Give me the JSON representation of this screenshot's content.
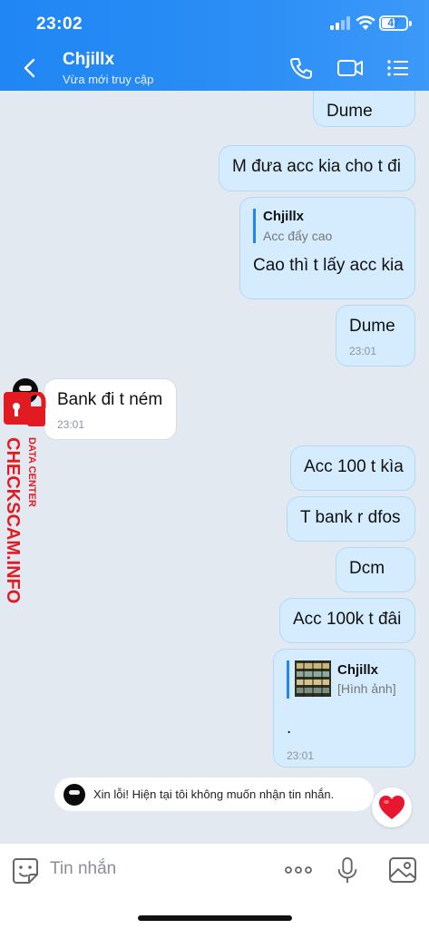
{
  "status_bar": {
    "time": "23:02",
    "battery": "47"
  },
  "header": {
    "contact_name": "Chjillx",
    "status": "Vừa mới truy cập"
  },
  "messages": {
    "m1": {
      "text": "Dume"
    },
    "m2": {
      "text": "M đưa acc kia cho t đi"
    },
    "m3": {
      "quote_name": "Chjillx",
      "quote_text": "Acc đẩy cao",
      "text": "Cao thì t lấy acc kia"
    },
    "m4": {
      "text": "Dume",
      "time": "23:01"
    },
    "m5": {
      "text": "Bank đi t ném",
      "time": "23:01"
    },
    "m6": {
      "text": "Acc 100 t kìa"
    },
    "m7": {
      "text": "T bank r dfos"
    },
    "m8": {
      "text": "Dcm"
    },
    "m9": {
      "text": "Acc 100k t đâi"
    },
    "m10": {
      "quote_name": "Chjillx",
      "quote_text": "[Hình ảnh]",
      "text": ".",
      "time": "23:01"
    }
  },
  "watermark": {
    "line1": "DATA CENTER",
    "line2": "CHECKSCAM.INFO"
  },
  "notice": {
    "text": "Xin lỗi! Hiện tại tôi không muốn nhận tin nhắn."
  },
  "input": {
    "placeholder": "Tin nhắn"
  },
  "colors": {
    "header": "#1f86f3",
    "bubble_out": "#d5ecfe",
    "watermark": "#e21b23"
  }
}
